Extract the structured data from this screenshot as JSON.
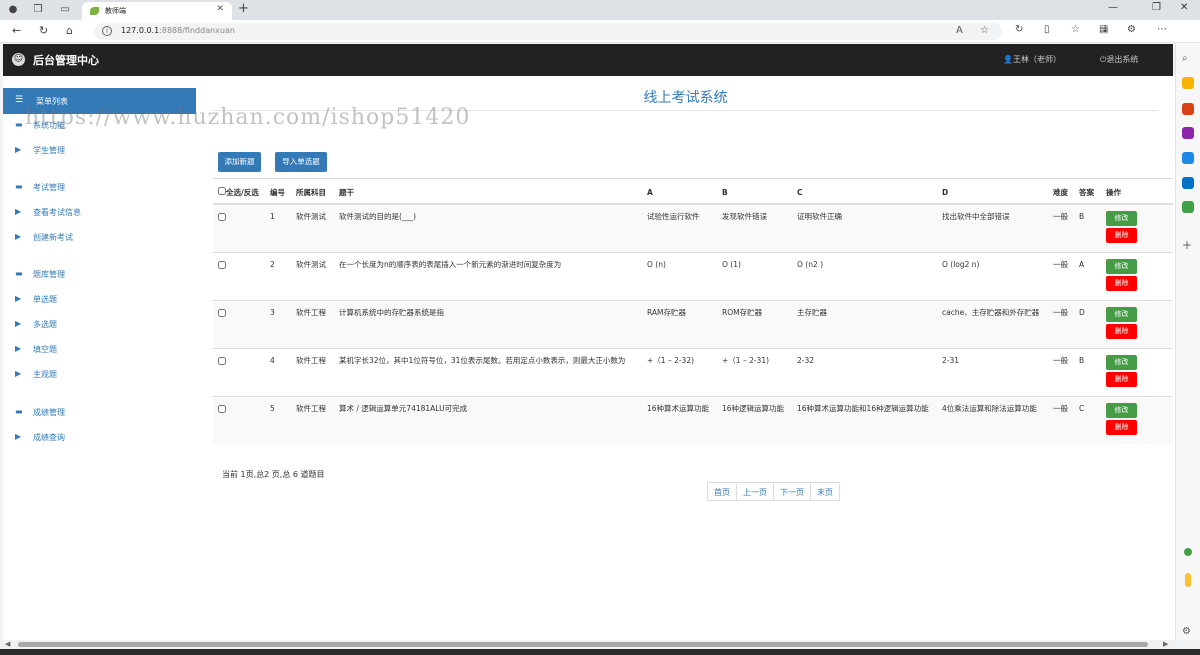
{
  "browser": {
    "tab_title": "教师端",
    "url_host": "127.0.0.1",
    "url_path": ":8888/finddanxuan"
  },
  "header": {
    "app_title": "后台管理中心",
    "user_label": "王林（老师）",
    "logout_label": "退出系统"
  },
  "sidebar": {
    "menu_title": "菜单列表",
    "items": [
      {
        "label": "系统功能",
        "type": "group"
      },
      {
        "label": "学生管理",
        "type": "item"
      },
      {
        "label": "考试管理",
        "type": "group"
      },
      {
        "label": "查看考试信息",
        "type": "item"
      },
      {
        "label": "创建新考试",
        "type": "item"
      },
      {
        "label": "题库管理",
        "type": "group"
      },
      {
        "label": "单选题",
        "type": "item"
      },
      {
        "label": "多选题",
        "type": "item"
      },
      {
        "label": "填空题",
        "type": "item"
      },
      {
        "label": "主观题",
        "type": "item"
      },
      {
        "label": "成绩管理",
        "type": "group"
      },
      {
        "label": "成绩查询",
        "type": "item"
      }
    ]
  },
  "watermark": "https://www.huzhan.com/ishop51420",
  "main": {
    "heading": "线上考试系统",
    "add_button": "添加新题",
    "import_button": "导入单选题",
    "table": {
      "headers": {
        "select_all": "全选/反选",
        "no": "编号",
        "subject": "所属科目",
        "stem": "题干",
        "a": "A",
        "b": "B",
        "c": "C",
        "d": "D",
        "difficulty": "难度",
        "answer": "答案",
        "ops": "操作"
      },
      "rows": [
        {
          "no": "1",
          "subject": "软件测试",
          "stem": "软件测试的目的是(___)",
          "a": "试验性运行软件",
          "b": "发现软件错误",
          "c": "证明软件正确",
          "d": "找出软件中全部错误",
          "difficulty": "一般",
          "answer": "B"
        },
        {
          "no": "2",
          "subject": "软件测试",
          "stem": "在一个长度为n的顺序表的表尾插入一个新元素的渐进时间复杂度为",
          "a": "O (n)",
          "b": "O (1)",
          "c": "O (n2 )",
          "d": "O (log2 n)",
          "difficulty": "一般",
          "answer": "A"
        },
        {
          "no": "3",
          "subject": "软件工程",
          "stem": "计算机系统中的存贮器系统是指",
          "a": "RAM存贮器",
          "b": "ROM存贮器",
          "c": "主存贮器",
          "d": "cache、主存贮器和外存贮器",
          "difficulty": "一般",
          "answer": "D"
        },
        {
          "no": "4",
          "subject": "软件工程",
          "stem": "某机字长32位，其中1位符号位，31位表示尾数。若用定点小数表示，则最大正小数为",
          "a": "+（1 – 2-32)",
          "b": "+（1 – 2-31)",
          "c": "2-32",
          "d": "2-31",
          "difficulty": "一般",
          "answer": "B"
        },
        {
          "no": "5",
          "subject": "软件工程",
          "stem": "算术 / 逻辑运算单元74181ALU可完成",
          "a": "16种算术运算功能",
          "b": "16种逻辑运算功能",
          "c": "16种算术运算功能和16种逻辑运算功能",
          "d": "4位乘法运算和除法运算功能",
          "difficulty": "一般",
          "answer": "C"
        }
      ],
      "edit_label": "修改",
      "delete_label": "删除"
    },
    "page_info": "当前 1页,总2 页,总 6 道题目",
    "pager": {
      "first": "首页",
      "prev": "上一页",
      "next": "下一页",
      "last": "末页"
    }
  }
}
